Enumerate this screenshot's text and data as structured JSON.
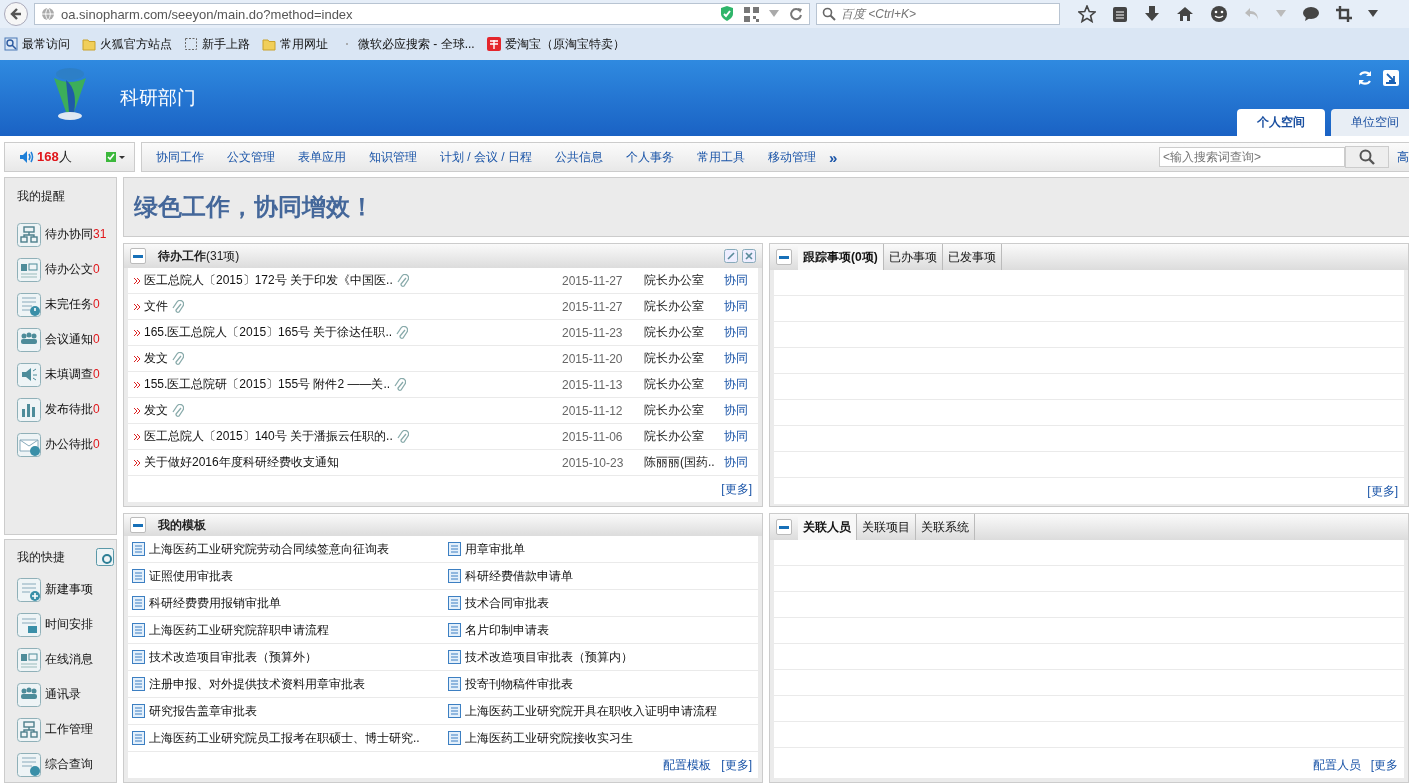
{
  "browser": {
    "url": "oa.sinopharm.com/seeyon/main.do?method=index",
    "search_placeholder": "百度 <Ctrl+K>",
    "bookmarks": [
      {
        "label": "最常访问",
        "kind": "history"
      },
      {
        "label": "火狐官方站点",
        "kind": "folder"
      },
      {
        "label": "新手上路",
        "kind": "dashed"
      },
      {
        "label": "常用网址",
        "kind": "folder"
      },
      {
        "label": "微软必应搜索 - 全球...",
        "kind": "dot"
      },
      {
        "label": "爱淘宝（原淘宝特卖）",
        "kind": "shop"
      }
    ]
  },
  "header": {
    "title": "科研部门",
    "tabs": [
      {
        "label": "个人空间",
        "selected": true
      },
      {
        "label": "单位空间",
        "selected": false
      }
    ]
  },
  "online": {
    "count": "168",
    "unit": "人"
  },
  "nav": {
    "items": [
      "协同工作",
      "公文管理",
      "表单应用",
      "知识管理",
      "计划 / 会议 / 日程",
      "公共信息",
      "个人事务",
      "常用工具",
      "移动管理"
    ],
    "more": "»",
    "search_placeholder": "<输入搜索词查询>",
    "cut_link": "高"
  },
  "reminders": {
    "title": "我的提醒",
    "items": [
      {
        "label": "待办协同",
        "count": "31",
        "kind": "flow"
      },
      {
        "label": "待办公文",
        "count": "0",
        "kind": "card"
      },
      {
        "label": "未完任务",
        "count": "0",
        "kind": "task"
      },
      {
        "label": "会议通知",
        "count": "0",
        "kind": "people"
      },
      {
        "label": "未填调查",
        "count": "0",
        "kind": "speaker"
      },
      {
        "label": "发布待批",
        "count": "0",
        "kind": "chart"
      },
      {
        "label": "办公待批",
        "count": "0",
        "kind": "mail"
      }
    ]
  },
  "shortcuts": {
    "title": "我的快捷",
    "items": [
      {
        "label": "新建事项",
        "kind": "new"
      },
      {
        "label": "时间安排",
        "kind": "calendar"
      },
      {
        "label": "在线消息",
        "kind": "card"
      },
      {
        "label": "通讯录",
        "kind": "people"
      },
      {
        "label": "工作管理",
        "kind": "flow"
      },
      {
        "label": "综合查询",
        "kind": "task"
      }
    ]
  },
  "banner": {
    "text": "绿色工作，协同增效！"
  },
  "pending": {
    "title": "待办工作",
    "count": "(31项)",
    "more": "[更多]",
    "rows": [
      {
        "title": "医工总院人〔2015〕172号 关于印发《中国医..",
        "attachment": true,
        "date": "2015-11-27",
        "sender": "院长办公室",
        "type": "协同"
      },
      {
        "title": "文件",
        "attachment": true,
        "date": "2015-11-27",
        "sender": "院长办公室",
        "type": "协同"
      },
      {
        "title": "165.医工总院人〔2015〕165号 关于徐达任职..",
        "attachment": true,
        "date": "2015-11-23",
        "sender": "院长办公室",
        "type": "协同"
      },
      {
        "title": "发文",
        "attachment": true,
        "date": "2015-11-20",
        "sender": "院长办公室",
        "type": "协同"
      },
      {
        "title": "155.医工总院研〔2015〕155号 附件2 ——关..",
        "attachment": true,
        "date": "2015-11-13",
        "sender": "院长办公室",
        "type": "协同"
      },
      {
        "title": "发文",
        "attachment": true,
        "date": "2015-11-12",
        "sender": "院长办公室",
        "type": "协同"
      },
      {
        "title": "医工总院人〔2015〕140号 关于潘振云任职的..",
        "attachment": true,
        "date": "2015-11-06",
        "sender": "院长办公室",
        "type": "协同"
      },
      {
        "title": "关于做好2016年度科研经费收支通知",
        "attachment": false,
        "date": "2015-10-23",
        "sender": "陈丽丽(国药..",
        "type": "协同"
      }
    ]
  },
  "tracking": {
    "tabs": [
      {
        "label": "跟踪事项(0项)",
        "selected": true
      },
      {
        "label": "已办事项",
        "selected": false
      },
      {
        "label": "已发事项",
        "selected": false
      }
    ],
    "more": "[更多]"
  },
  "templates": {
    "title": "我的模板",
    "items": [
      "上海医药工业研究院劳动合同续签意向征询表",
      "用章审批单",
      "证照使用审批表",
      "科研经费借款申请单",
      "科研经费费用报销审批单",
      "技术合同审批表",
      "上海医药工业研究院辞职申请流程",
      "名片印制申请表",
      "技术改造项目审批表（预算外）",
      "技术改造项目审批表（预算内）",
      "注册申报、对外提供技术资料用章审批表",
      "投寄刊物稿件审批表",
      "研究报告盖章审批表",
      "上海医药工业研究院开具在职收入证明申请流程",
      "上海医药工业研究院员工报考在职硕士、博士研究..",
      "上海医药工业研究院接收实习生"
    ],
    "config": "配置模板",
    "more": "[更多]"
  },
  "related": {
    "tabs": [
      {
        "label": "关联人员",
        "selected": true
      },
      {
        "label": "关联项目",
        "selected": false
      },
      {
        "label": "关联系统",
        "selected": false
      }
    ],
    "config": "配置人员",
    "more": "[更多"
  }
}
